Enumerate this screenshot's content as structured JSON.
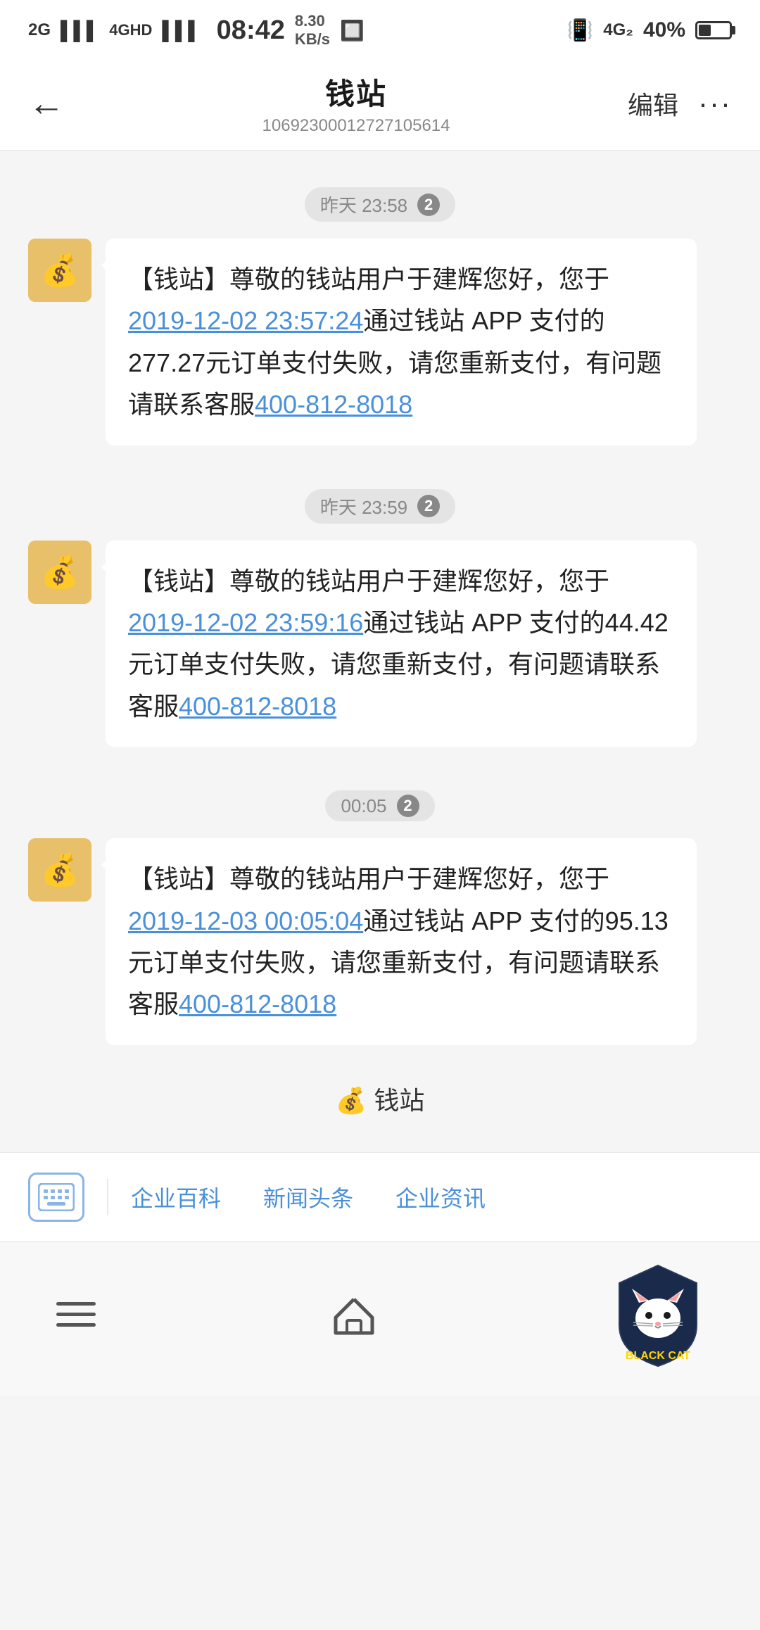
{
  "statusBar": {
    "time": "08:42",
    "networkSpeed": "8.30\nKB/s",
    "signal2g": "2G",
    "signal4ghd": "4GHD",
    "signal4g": "4G₂",
    "vibrate": "",
    "battery": "40%"
  },
  "navBar": {
    "back": "←",
    "title": "钱站",
    "subtitle": "10692300012727105614",
    "edit": "编辑",
    "more": "···"
  },
  "messages": [
    {
      "timestamp": "昨天 23:58",
      "badge": "2",
      "text": "【钱站】尊敬的钱站用户于建辉您好，您于",
      "link": "2019-12-02 23:57:24",
      "textAfterLink": "通过钱站 APP 支付的277.27元订单支付失败，请您重新支付，有问题请联系客服",
      "phone": "400-812-8018"
    },
    {
      "timestamp": "昨天 23:59",
      "badge": "2",
      "text": "【钱站】尊敬的钱站用户于建辉您好，您于",
      "link": "2019-12-02 23:59:16",
      "textAfterLink": "通过钱站 APP 支付的44.42元订单支付失败，请您重新支付，有问题请联系客服",
      "phone": "400-812-8018"
    },
    {
      "timestamp": "00:05",
      "badge": "2",
      "text": "【钱站】尊敬的钱站用户于建辉您好，您于",
      "link": "2019-12-03 00:05:04",
      "textAfterLink": "通过钱站 APP 支付的95.13元订单支付失败，请您重新支付，有问题请联系客服",
      "phone": "400-812-8018"
    }
  ],
  "qianzhanLabel": "💰 钱站",
  "toolbar": {
    "keyboardTitle": "键盘",
    "links": [
      "企业百科",
      "新闻头条",
      "企业资讯"
    ]
  },
  "bottomNav": {
    "menu": "菜单",
    "home": "首页",
    "blackcat": "BLACK CAT"
  }
}
